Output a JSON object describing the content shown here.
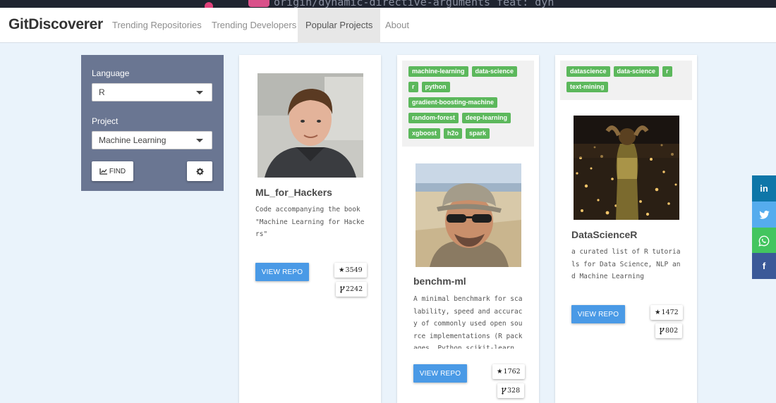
{
  "background_strip": {
    "text": "origin/dynamic-directive-arguments   feat: dyn"
  },
  "brand": "GitDiscoverer",
  "nav": [
    {
      "label": "Trending Repositories"
    },
    {
      "label": "Trending Developers"
    },
    {
      "label": "Popular Projects",
      "active": true
    },
    {
      "label": "About"
    }
  ],
  "sidebar": {
    "language_label": "Language",
    "language_value": "R",
    "project_label": "Project",
    "project_value": "Machine Learning",
    "find_label": "FIND",
    "settings_icon": "gear-icon"
  },
  "cards": [
    {
      "tags": [],
      "title": "ML_for_Hackers",
      "description": "Code accompanying the book \"Machine Learning for Hackers\"",
      "button": "VIEW REPO",
      "stars": "3549",
      "forks": "2242"
    },
    {
      "tags": [
        "machine-learning",
        "data-science",
        "r",
        "python",
        "gradient-boosting-machine",
        "random-forest",
        "deep-learning",
        "xgboost",
        "h2o",
        "spark"
      ],
      "title": "benchm-ml",
      "description": "A minimal benchmark for scalability, speed and accuracy of commonly used open source implementations (R packages, Python scikit-learn",
      "button": "VIEW REPO",
      "stars": "1762",
      "forks": "328"
    },
    {
      "tags": [
        "datascience",
        "data-science",
        "r",
        "text-mining"
      ],
      "title": "DataScienceR",
      "description": "a curated list of R tutorials for Data Science, NLP and Machine Learning",
      "button": "VIEW REPO",
      "stars": "1472",
      "forks": "802"
    }
  ],
  "social": [
    {
      "label": "in",
      "icon": "linkedin-icon",
      "color": "#0e76a8"
    },
    {
      "label": "twitter",
      "icon": "twitter-icon",
      "color": "#55acee"
    },
    {
      "label": "whatsapp",
      "icon": "whatsapp-icon",
      "color": "#43c55f"
    },
    {
      "label": "f",
      "icon": "facebook-icon",
      "color": "#3b5998"
    }
  ]
}
